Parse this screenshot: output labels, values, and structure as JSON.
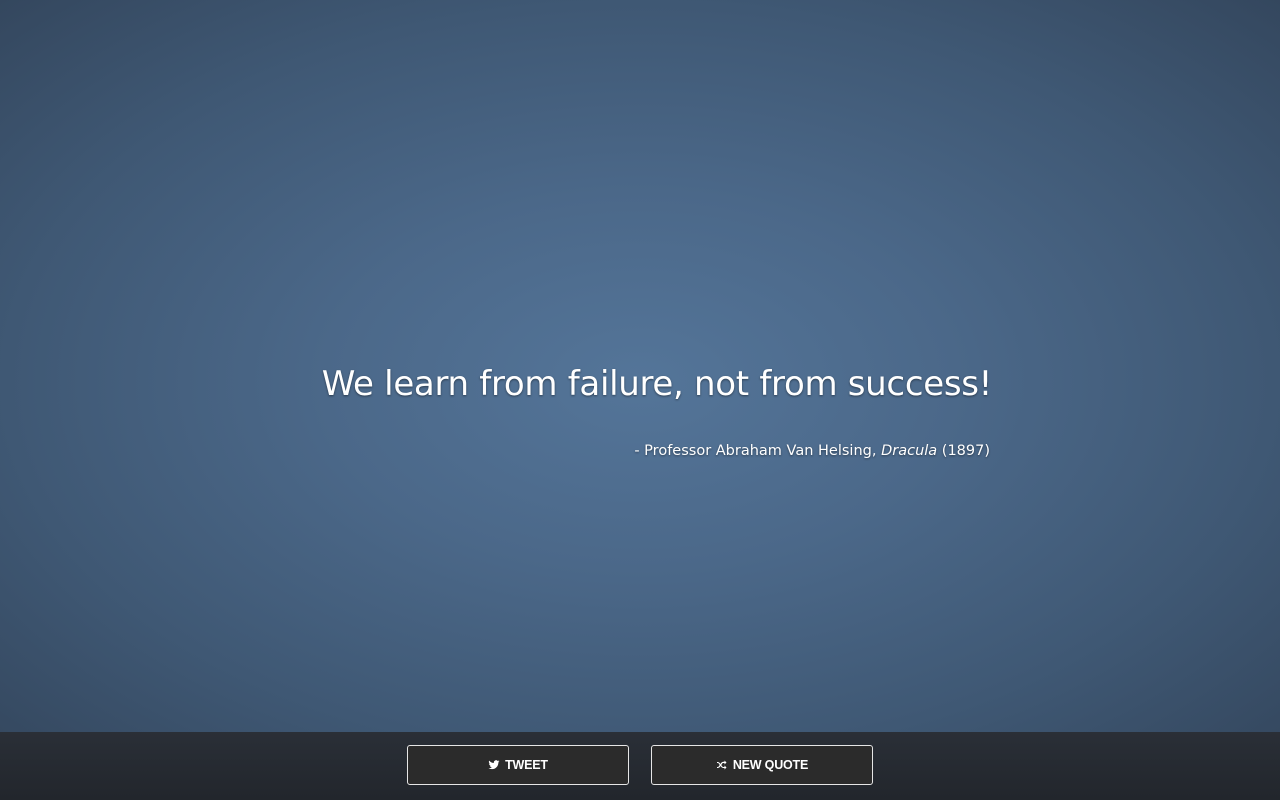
{
  "quote": {
    "text": "We learn from failure, not from success!",
    "prefix": "- Professor Abraham Van Helsing, ",
    "work": "Dracula",
    "year": " (1897)"
  },
  "footer": {
    "tweet_label": "TWEET",
    "tweet_icon": "twitter-icon",
    "new_quote_label": "NEW QUOTE",
    "new_quote_icon": "shuffle-icon"
  },
  "colors": {
    "background_center": "#547599",
    "background_edge": "#34475e",
    "footer": "#22262c",
    "button_bg": "#2b2b2b",
    "button_border": "#e6e6e6",
    "text": "#ffffff"
  }
}
